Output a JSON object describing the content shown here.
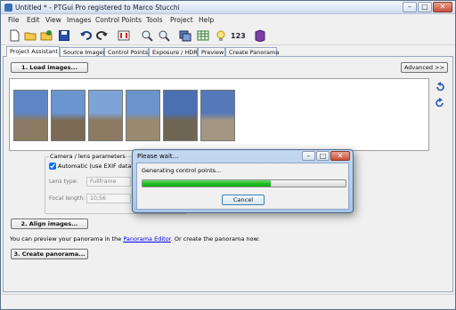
{
  "window": {
    "title": "Untitled * - PTGui Pro registered to Marco Stucchi"
  },
  "menu": [
    "File",
    "Edit",
    "View",
    "Images",
    "Control Points",
    "Tools",
    "Project",
    "Help"
  ],
  "toolbar": {
    "number_label": "123"
  },
  "tabs": [
    "Project Assistant",
    "Source Images",
    "Control Points",
    "Exposure / HDR",
    "Preview",
    "Create Panorama"
  ],
  "assistant": {
    "load_images": "1. Load images...",
    "advanced": "Advanced >>",
    "camera_group": "Camera / lens parameters",
    "automatic_label": "Automatic (use EXIF data fro",
    "automatic_checked": true,
    "lens_type_label": "Lens type:",
    "lens_type_value": "Fullframe",
    "focal_length_label": "Focal length:",
    "focal_length_value": "10,56",
    "align_images": "2. Align images...",
    "preview_text_before": "You can preview your panorama in the ",
    "panorama_editor_link": "Panorama Editor",
    "preview_text_after": ". Or create the panorama now:",
    "create_panorama": "3. Create panorama..."
  },
  "thumbnails": [
    {
      "name": "thumb-1",
      "sky": "#5f86c4",
      "ground": "#8a7a63"
    },
    {
      "name": "thumb-2",
      "sky": "#6a95cf",
      "ground": "#7a6a55"
    },
    {
      "name": "thumb-3",
      "sky": "#7ea3d6",
      "ground": "#8c7b62"
    },
    {
      "name": "thumb-4",
      "sky": "#6b93cc",
      "ground": "#9b8a70"
    },
    {
      "name": "thumb-5",
      "sky": "#4a70b2",
      "ground": "#6f6555"
    },
    {
      "name": "thumb-6",
      "sky": "#5478b8",
      "ground": "#a39682"
    }
  ],
  "dialog": {
    "title": "Please wait...",
    "message": "Generating control points...",
    "cancel": "Cancel",
    "progress": 0.63
  },
  "colors": {
    "link": "#0000ee",
    "progress": "#22c022"
  }
}
